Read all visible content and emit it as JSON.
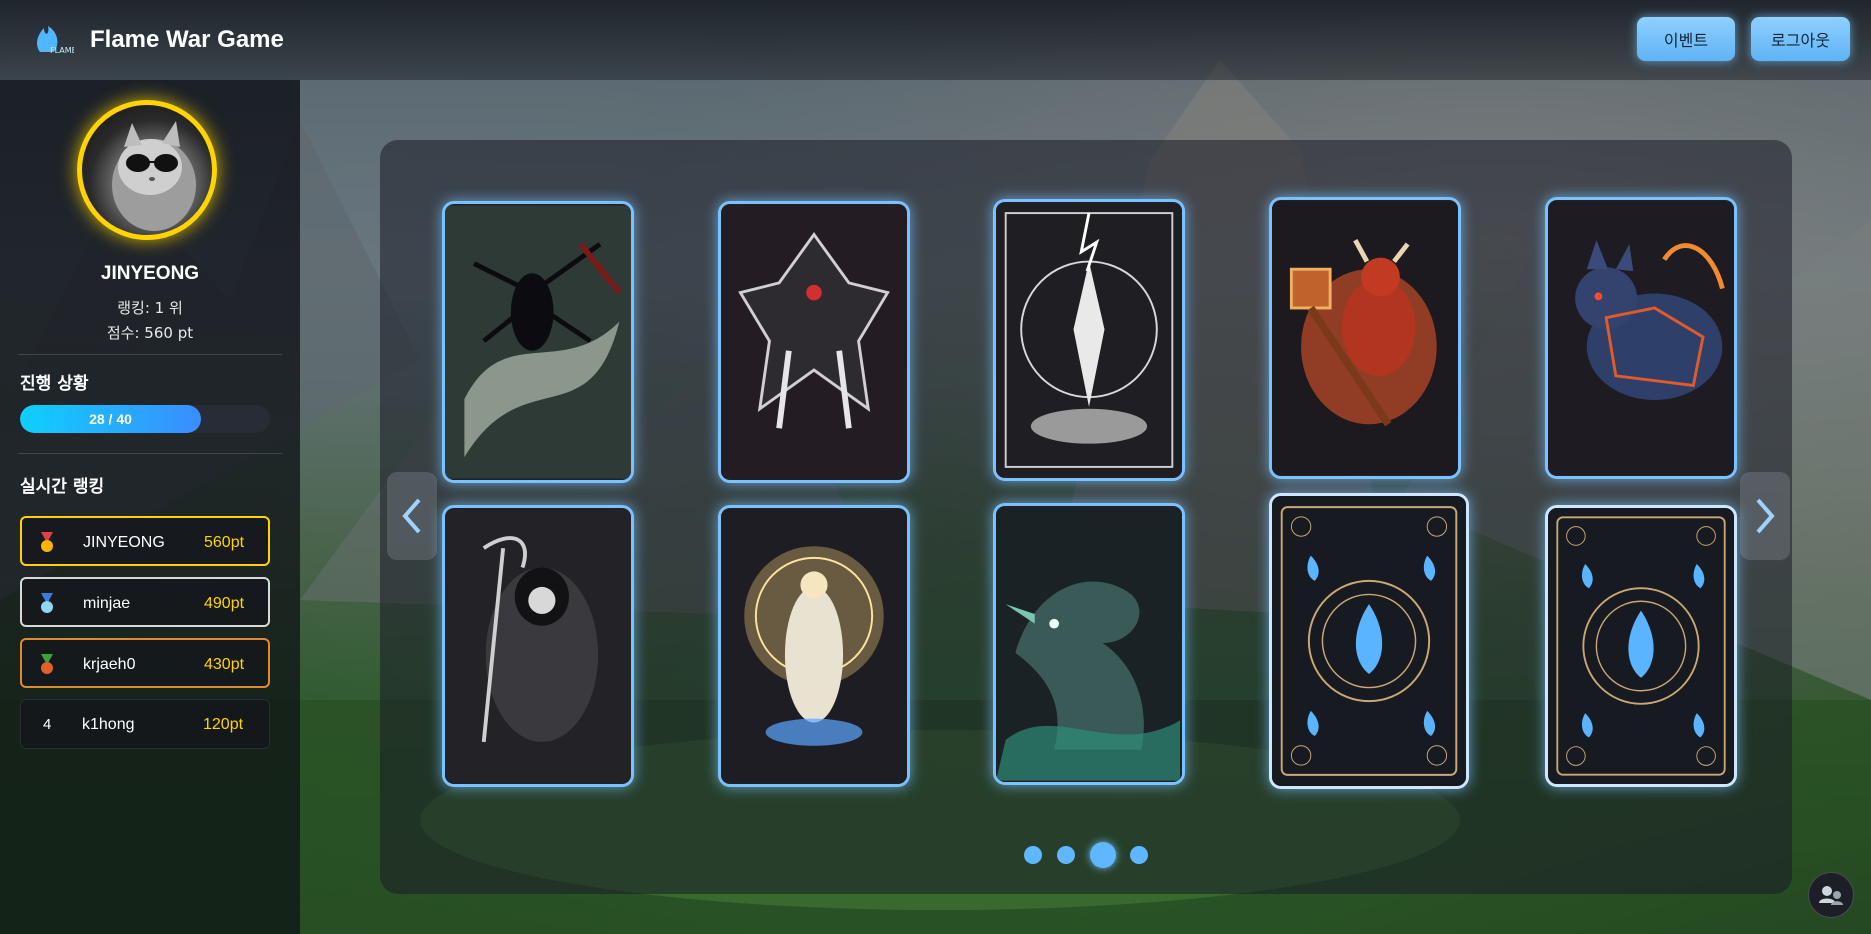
{
  "header": {
    "app_title": "Flame War Game",
    "logo_text": "FLAME",
    "event_button": "이벤트",
    "logout_button": "로그아웃"
  },
  "profile": {
    "username": "JINYEONG",
    "rank_text": "랭킹: 1 위",
    "score_text": "점수: 560 pt"
  },
  "progress": {
    "title": "진행 상황",
    "label": "28 / 40",
    "current": 28,
    "total": 40
  },
  "ranking": {
    "title": "실시간 랭킹",
    "items": [
      {
        "rank": 1,
        "name": "JINYEONG",
        "points": "560pt",
        "medal": "gold-medal-icon",
        "border": "#ffd400"
      },
      {
        "rank": 2,
        "name": "minjae",
        "points": "490pt",
        "medal": "silver-medal-icon",
        "border": "#d9d9d9"
      },
      {
        "rank": 3,
        "name": "krjaeh0",
        "points": "430pt",
        "medal": "bronze-medal-icon",
        "border": "#e08a2e"
      },
      {
        "rank": "4",
        "name": "k1hong",
        "points": "120pt",
        "medal": null,
        "border": "#2a2d33"
      }
    ]
  },
  "cards": [
    {
      "id": "shadow-wraith",
      "face": "up"
    },
    {
      "id": "dark-demon-lord",
      "face": "up"
    },
    {
      "id": "lightning-goddess",
      "face": "up"
    },
    {
      "id": "hammer-demon",
      "face": "up"
    },
    {
      "id": "flame-wolf",
      "face": "up"
    },
    {
      "id": "grim-reaper",
      "face": "up"
    },
    {
      "id": "radiant-paladin",
      "face": "up"
    },
    {
      "id": "sea-dragon",
      "face": "up"
    },
    {
      "id": "card-back",
      "face": "down"
    },
    {
      "id": "card-back",
      "face": "down"
    }
  ],
  "pagination": {
    "pages": 4,
    "active": 3
  },
  "colors": {
    "accent": "#79c2ff",
    "gold": "#ffd400",
    "points": "#ffd400"
  }
}
